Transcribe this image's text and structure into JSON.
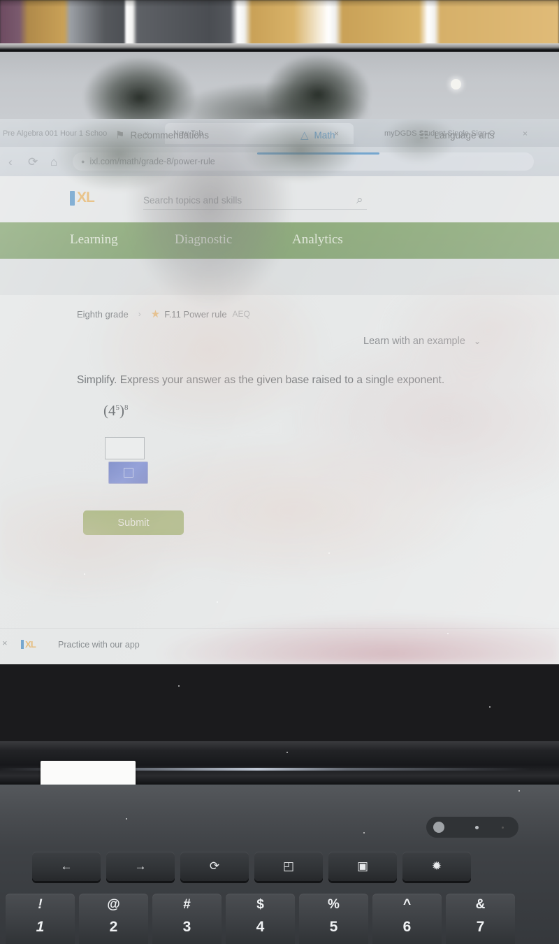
{
  "photo": {
    "scene": "photo-of-chromebook-screen",
    "device": "chromebook"
  },
  "browser": {
    "tabs": [
      {
        "title": "Pre Algebra 001 Hour 1 Schoo",
        "active": false,
        "close_label": "×"
      },
      {
        "title": "New Tab",
        "active": true,
        "close_label": "×"
      },
      {
        "title": "myDGDS Student Single Sign-O",
        "active": false,
        "close_label": "×"
      }
    ],
    "nav": {
      "back_icon": "‹",
      "reload_icon": "⟳",
      "home_icon": "⌂"
    },
    "omnibox": {
      "lock_icon": "●",
      "url": "ixl.com/math/grade-8/power-rule"
    }
  },
  "ixl": {
    "logo_word": "XL",
    "search": {
      "placeholder": "Search topics and skills",
      "value": "",
      "icon": "⌕"
    },
    "green_nav": [
      {
        "label": "Learning"
      },
      {
        "label": "Diagnostic"
      },
      {
        "label": "Analytics"
      }
    ],
    "subtabs": [
      {
        "label": "Recommendations",
        "icon": "⚑",
        "active": false
      },
      {
        "label": "Math",
        "icon": "△",
        "active": true
      },
      {
        "label": "Language arts",
        "icon": "☷",
        "active": false
      }
    ],
    "breadcrumb": {
      "grade": "Eighth grade",
      "separator": "›",
      "star_icon": "★",
      "skill": "F.11 Power rule",
      "code": "AEQ"
    },
    "learn_example": {
      "label": "Learn with an example",
      "chevron": "⌄"
    },
    "question": {
      "prompt": "Simplify. Express your answer as the given base raised to a single exponent.",
      "expression_base": "4",
      "expression_inner_exponent": "5",
      "expression_outer_exponent": "8",
      "expression_plain": "(4^5)^8",
      "answer_value": ""
    },
    "submit_label": "Submit",
    "promo": {
      "close_icon": "×",
      "logo_word": "XL",
      "text": "Practice with our app"
    }
  },
  "keyboard": {
    "function_keys": [
      {
        "name": "back",
        "glyph": "←"
      },
      {
        "name": "forward",
        "glyph": "→"
      },
      {
        "name": "reload",
        "glyph": "⟳"
      },
      {
        "name": "fullscreen",
        "glyph": "◰"
      },
      {
        "name": "overview",
        "glyph": "▣"
      },
      {
        "name": "brightness",
        "glyph": "✹"
      }
    ],
    "number_keys": [
      {
        "symbol": "!",
        "number": "1"
      },
      {
        "symbol": "@",
        "number": "2"
      },
      {
        "symbol": "#",
        "number": "3"
      },
      {
        "symbol": "$",
        "number": "4"
      },
      {
        "symbol": "%",
        "number": "5"
      },
      {
        "symbol": "^",
        "number": "6"
      },
      {
        "symbol": "&",
        "number": "7"
      }
    ]
  },
  "colors": {
    "ixl_green": "#5e8a3f",
    "ixl_orange": "#e8a33d",
    "ixl_blue": "#2f7fc1",
    "submit_green": "#7f9c3a"
  }
}
